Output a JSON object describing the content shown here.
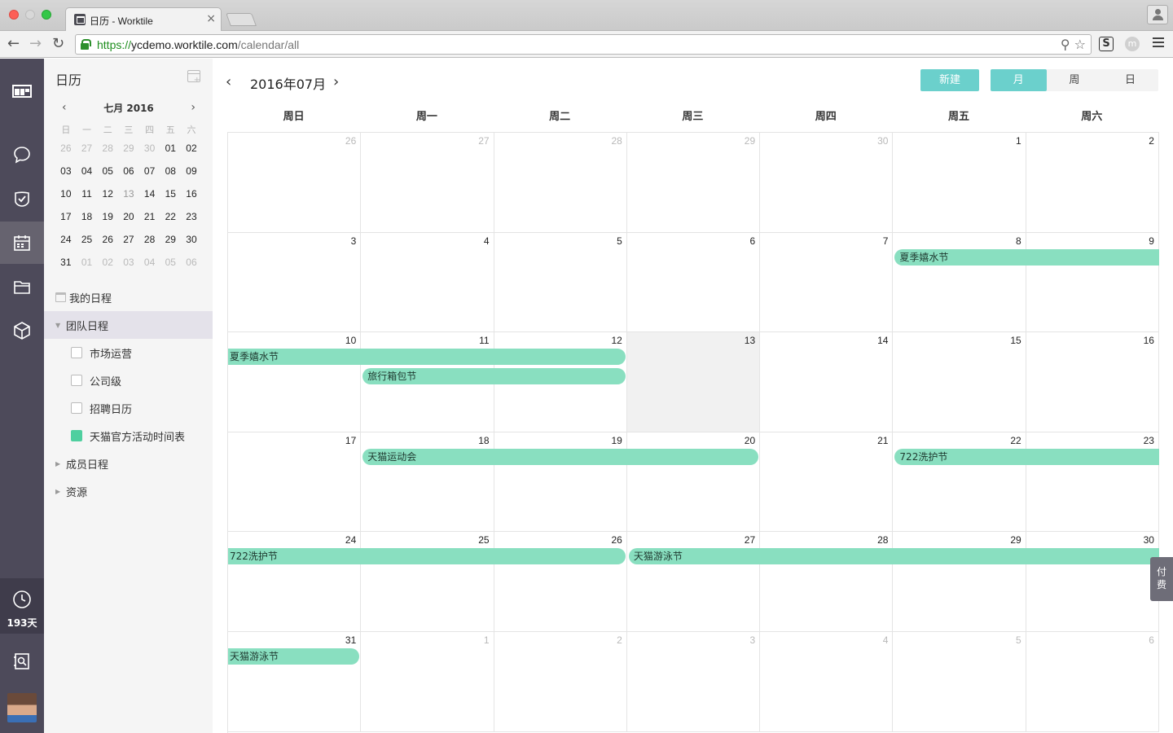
{
  "browser": {
    "tab_title": "日历 - Worktile",
    "url_scheme": "https://",
    "url_host": "ycdemo.worktile.com",
    "url_path": "/calendar/all",
    "ext_s": "S",
    "ext_m": "m"
  },
  "rail": {
    "trial_days": "193天",
    "items": [
      "dashboard-icon",
      "chat-icon",
      "task-icon",
      "calendar-icon",
      "folder-icon",
      "cube-icon"
    ]
  },
  "sidebar": {
    "title": "日历",
    "mini_calendar": {
      "title": "七月 2016",
      "weekdays": [
        "日",
        "一",
        "二",
        "三",
        "四",
        "五",
        "六"
      ],
      "weeks": [
        [
          "26",
          "27",
          "28",
          "29",
          "30",
          "01",
          "02"
        ],
        [
          "03",
          "04",
          "05",
          "06",
          "07",
          "08",
          "09"
        ],
        [
          "10",
          "11",
          "12",
          "13",
          "14",
          "15",
          "16"
        ],
        [
          "17",
          "18",
          "19",
          "20",
          "21",
          "22",
          "23"
        ],
        [
          "24",
          "25",
          "26",
          "27",
          "28",
          "29",
          "30"
        ],
        [
          "31",
          "01",
          "02",
          "03",
          "04",
          "05",
          "06"
        ]
      ]
    },
    "my_schedule": "我的日程",
    "team_schedule": "团队日程",
    "team_calendars": [
      {
        "label": "市场运营",
        "checked": false
      },
      {
        "label": "公司级",
        "checked": false
      },
      {
        "label": "招聘日历",
        "checked": false
      },
      {
        "label": "天猫官方活动时间表",
        "checked": true,
        "color": "#4fcf9f"
      }
    ],
    "member_schedule": "成员日程",
    "resources": "资源"
  },
  "main": {
    "title": "2016年07月",
    "new_label": "新建",
    "views": [
      {
        "label": "月",
        "active": true
      },
      {
        "label": "周",
        "active": false
      },
      {
        "label": "日",
        "active": false
      }
    ],
    "weekdays": [
      "周日",
      "周一",
      "周二",
      "周三",
      "周四",
      "周五",
      "周六"
    ],
    "weeks": [
      [
        "26",
        "27",
        "28",
        "29",
        "30",
        "1",
        "2"
      ],
      [
        "3",
        "4",
        "5",
        "6",
        "7",
        "8",
        "9"
      ],
      [
        "10",
        "11",
        "12",
        "13",
        "14",
        "15",
        "16"
      ],
      [
        "17",
        "18",
        "19",
        "20",
        "21",
        "22",
        "23"
      ],
      [
        "24",
        "25",
        "26",
        "27",
        "28",
        "29",
        "30"
      ],
      [
        "31",
        "1",
        "2",
        "3",
        "4",
        "5",
        "6"
      ]
    ],
    "today": "13",
    "events": [
      {
        "label": "夏季嬉水节",
        "week": 1,
        "start": 5,
        "end": 6,
        "lane": 0,
        "cont_right": true
      },
      {
        "label": "夏季嬉水节",
        "week": 2,
        "start": 0,
        "end": 2,
        "lane": 0,
        "cont_left": true
      },
      {
        "label": "旅行箱包节",
        "week": 2,
        "start": 1,
        "end": 2,
        "lane": 1
      },
      {
        "label": "天猫运动会",
        "week": 3,
        "start": 1,
        "end": 3,
        "lane": 0
      },
      {
        "label": "722洗护节",
        "week": 3,
        "start": 5,
        "end": 6,
        "lane": 0,
        "cont_right": true
      },
      {
        "label": "722洗护节",
        "week": 4,
        "start": 0,
        "end": 2,
        "lane": 0,
        "cont_left": true
      },
      {
        "label": "天猫游泳节",
        "week": 4,
        "start": 3,
        "end": 6,
        "lane": 0,
        "cont_right": true
      },
      {
        "label": "天猫游泳节",
        "week": 5,
        "start": 0,
        "end": 0,
        "lane": 0,
        "cont_left": true
      }
    ]
  },
  "pay_tab": "付费"
}
